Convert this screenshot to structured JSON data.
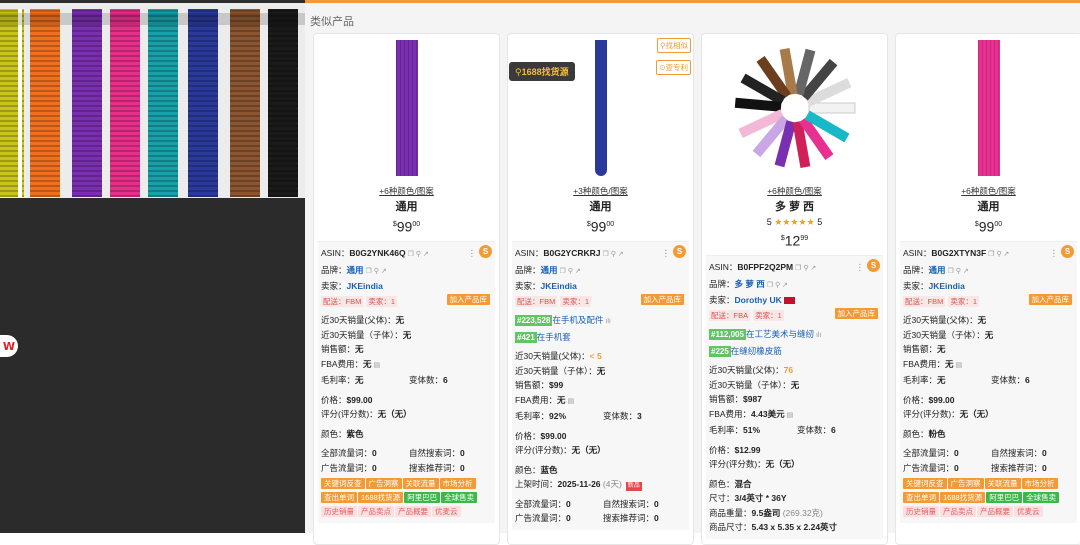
{
  "section_title": "类似产品",
  "labels": {
    "asin": "ASIN：",
    "brand": "品牌：",
    "seller": "卖家：",
    "delivery": "配送：",
    "seller_count": "卖家：",
    "add_to_lib": "加入产品库",
    "sales_parent": "近30天销量(父体)：",
    "sales_child": "近30天销量（子体）：",
    "revenue": "销售额：",
    "fba_fee": "FBA费用：",
    "margin": "毛利率：",
    "variants": "变体数：",
    "price": "价格：",
    "review": "评分(评分数)：",
    "color": "颜色：",
    "listing_date": "上架时间：",
    "size": "尺寸：",
    "weight": "商品重量：",
    "dimensions": "商品尺寸：",
    "all_traffic": "全部流量词：",
    "natural_search": "自然搜索词：",
    "ad_traffic": "广告流量词：",
    "search_recommend": "搜索推荐词：",
    "new_badge": "新品",
    "search_1688": "1688找货源",
    "find_similar": "找相似",
    "check_patent": "查专利",
    "buttons_row1": [
      "关键词反查",
      "广告洞察",
      "关联流量",
      "市场分析"
    ],
    "buttons_row2": [
      "查出单词",
      "1688找货源",
      "阿里巴巴",
      "全球售卖"
    ],
    "buttons_row3": [
      "历史销量",
      "产品卖点",
      "产品概要",
      "优麦云"
    ]
  },
  "products": [
    {
      "variants_text": "+6种颜色/图案",
      "brand_display": "通用",
      "price_whole": "99",
      "price_frac": "00",
      "asin": "B0G2YNK46Q",
      "brand": "通用",
      "seller": "JKEindia",
      "delivery": "FBM",
      "seller_count": "1",
      "sales_parent": "无",
      "sales_child": "无",
      "revenue": "无",
      "fba_fee": "无",
      "margin": "无",
      "variant_count": "6",
      "price": "$99.00",
      "review": "无（无）",
      "color": "紫色",
      "all_traffic": "0",
      "natural_search": "0",
      "ad_traffic": "0",
      "search_recommend": "0"
    },
    {
      "variants_text": "+3种颜色/图案",
      "brand_display": "通用",
      "price_whole": "99",
      "price_frac": "00",
      "asin": "B0G2YCRKRJ",
      "brand": "通用",
      "seller": "JKEindia",
      "delivery": "FBM",
      "seller_count": "1",
      "rank1_num": "#223,528",
      "rank1_cat": "在手机及配件",
      "rank2_num": "#421",
      "rank2_cat": "在手机套",
      "sales_parent": "< 5",
      "sales_child": "无",
      "revenue": "$99",
      "fba_fee": "无",
      "margin": "92%",
      "variant_count": "3",
      "price": "$99.00",
      "review": "无（无）",
      "color": "蓝色",
      "listing_date": "2025-11-26",
      "listing_days": "(4天)",
      "all_traffic": "0",
      "natural_search": "0",
      "ad_traffic": "0",
      "search_recommend": "0"
    },
    {
      "variants_text": "+6种颜色/图案",
      "brand_display": "多 萝 西",
      "rating_value": "5",
      "rating_stars": "★★★★★",
      "rating_count": "5",
      "price_whole": "12",
      "price_frac": "99",
      "asin": "B0FPF2Q2PM",
      "brand": "多 萝 西",
      "seller": "Dorothy UK",
      "delivery": "FBA",
      "seller_count": "1",
      "rank1_num": "#112,005",
      "rank1_cat": "在工艺美术与缝纫",
      "rank2_num": "#225",
      "rank2_cat": "在缝纫橡皮筋",
      "sales_parent": "76",
      "sales_child": "无",
      "revenue": "$987",
      "fba_fee": "4.43美元",
      "margin": "51%",
      "variant_count": "6",
      "price": "$12.99",
      "review": "无（无）",
      "color": "混合",
      "size": "3/4英寸 * 36Y",
      "weight": "9.5盎司",
      "weight_g": "(269.32克)",
      "dimensions": "5.43 x 5.35 x 2.24英寸"
    },
    {
      "variants_text": "+6种颜色/图案",
      "brand_display": "通用",
      "price_whole": "99",
      "price_frac": "00",
      "asin": "B0G2XTYN3F",
      "brand": "通用",
      "seller": "JKEindia",
      "delivery": "FBM",
      "seller_count": "1",
      "sales_parent": "无",
      "sales_child": "无",
      "revenue": "无",
      "fba_fee": "无",
      "margin": "无",
      "variant_count": "6",
      "price": "$99.00",
      "review": "无（无）",
      "color": "粉色",
      "all_traffic": "0",
      "natural_search": "0",
      "ad_traffic": "0",
      "search_recommend": "0"
    }
  ],
  "colors": {
    "accent": "#f39a34",
    "link": "#1a5fb4",
    "rank": "#62c462",
    "strap_colors": [
      "#c9c41a",
      "#f07020",
      "#7a2fb0",
      "#e8308a",
      "#18a0a8",
      "#2a3a9a",
      "#8a5530",
      "#1a1a1a"
    ]
  },
  "icons": [
    "wps-logo-icon",
    "search-icon",
    "flag-uk-icon",
    "sellersprite-logo-icon",
    "more-icon",
    "chart-icon",
    "calc-icon"
  ]
}
